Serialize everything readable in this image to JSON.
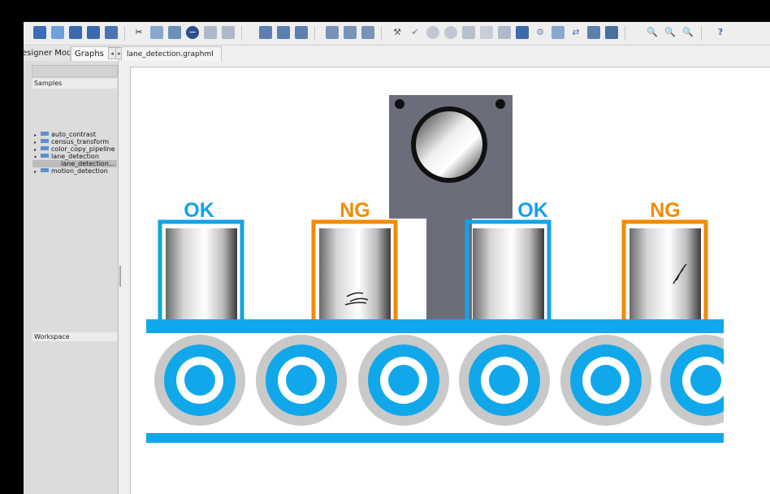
{
  "toolbar": {
    "icons": [
      "new-graph-icon",
      "open-icon",
      "save-icon",
      "save-as-icon",
      "save-all-icon",
      "cut-icon",
      "copy-icon",
      "paste-icon",
      "delete-icon",
      "expand-icon",
      "collapse-icon",
      "layout-1-icon",
      "layout-2-icon",
      "layout-3-icon",
      "group-icon",
      "align-left-icon",
      "align-top-icon",
      "build-icon",
      "check-icon",
      "play-icon",
      "stop-icon",
      "step-icon",
      "module-icon",
      "property-icon",
      "graph-icon",
      "gear-icon",
      "chart-icon",
      "refresh-icon",
      "window-icon",
      "export-icon",
      "zoom-in-icon",
      "zoom-out-icon",
      "zoom-fit-icon",
      "help-icon"
    ]
  },
  "left_tabs": {
    "designer": "esigner Mode",
    "graphs": "Graphs"
  },
  "samples": {
    "label": "Samples",
    "items": [
      {
        "label": "auto_contrast",
        "arrow": "▸"
      },
      {
        "label": "census_transform",
        "arrow": "▸"
      },
      {
        "label": "color_copy_pipeline",
        "arrow": "▸"
      },
      {
        "label": "lane_detection",
        "arrow": "▾"
      },
      {
        "label": "lane_detection...",
        "arrow": ""
      },
      {
        "label": "motion_detection",
        "arrow": "▸"
      }
    ]
  },
  "workspace": {
    "label": "Workspace"
  },
  "document_tab": "lane_detection.graphml",
  "diagram": {
    "labels": [
      "OK",
      "NG",
      "OK",
      "NG"
    ],
    "colors": {
      "ok": "#13a3e6",
      "ng": "#f08c00",
      "belt": "#10a8ea",
      "housing": "#6b6e7a"
    }
  }
}
